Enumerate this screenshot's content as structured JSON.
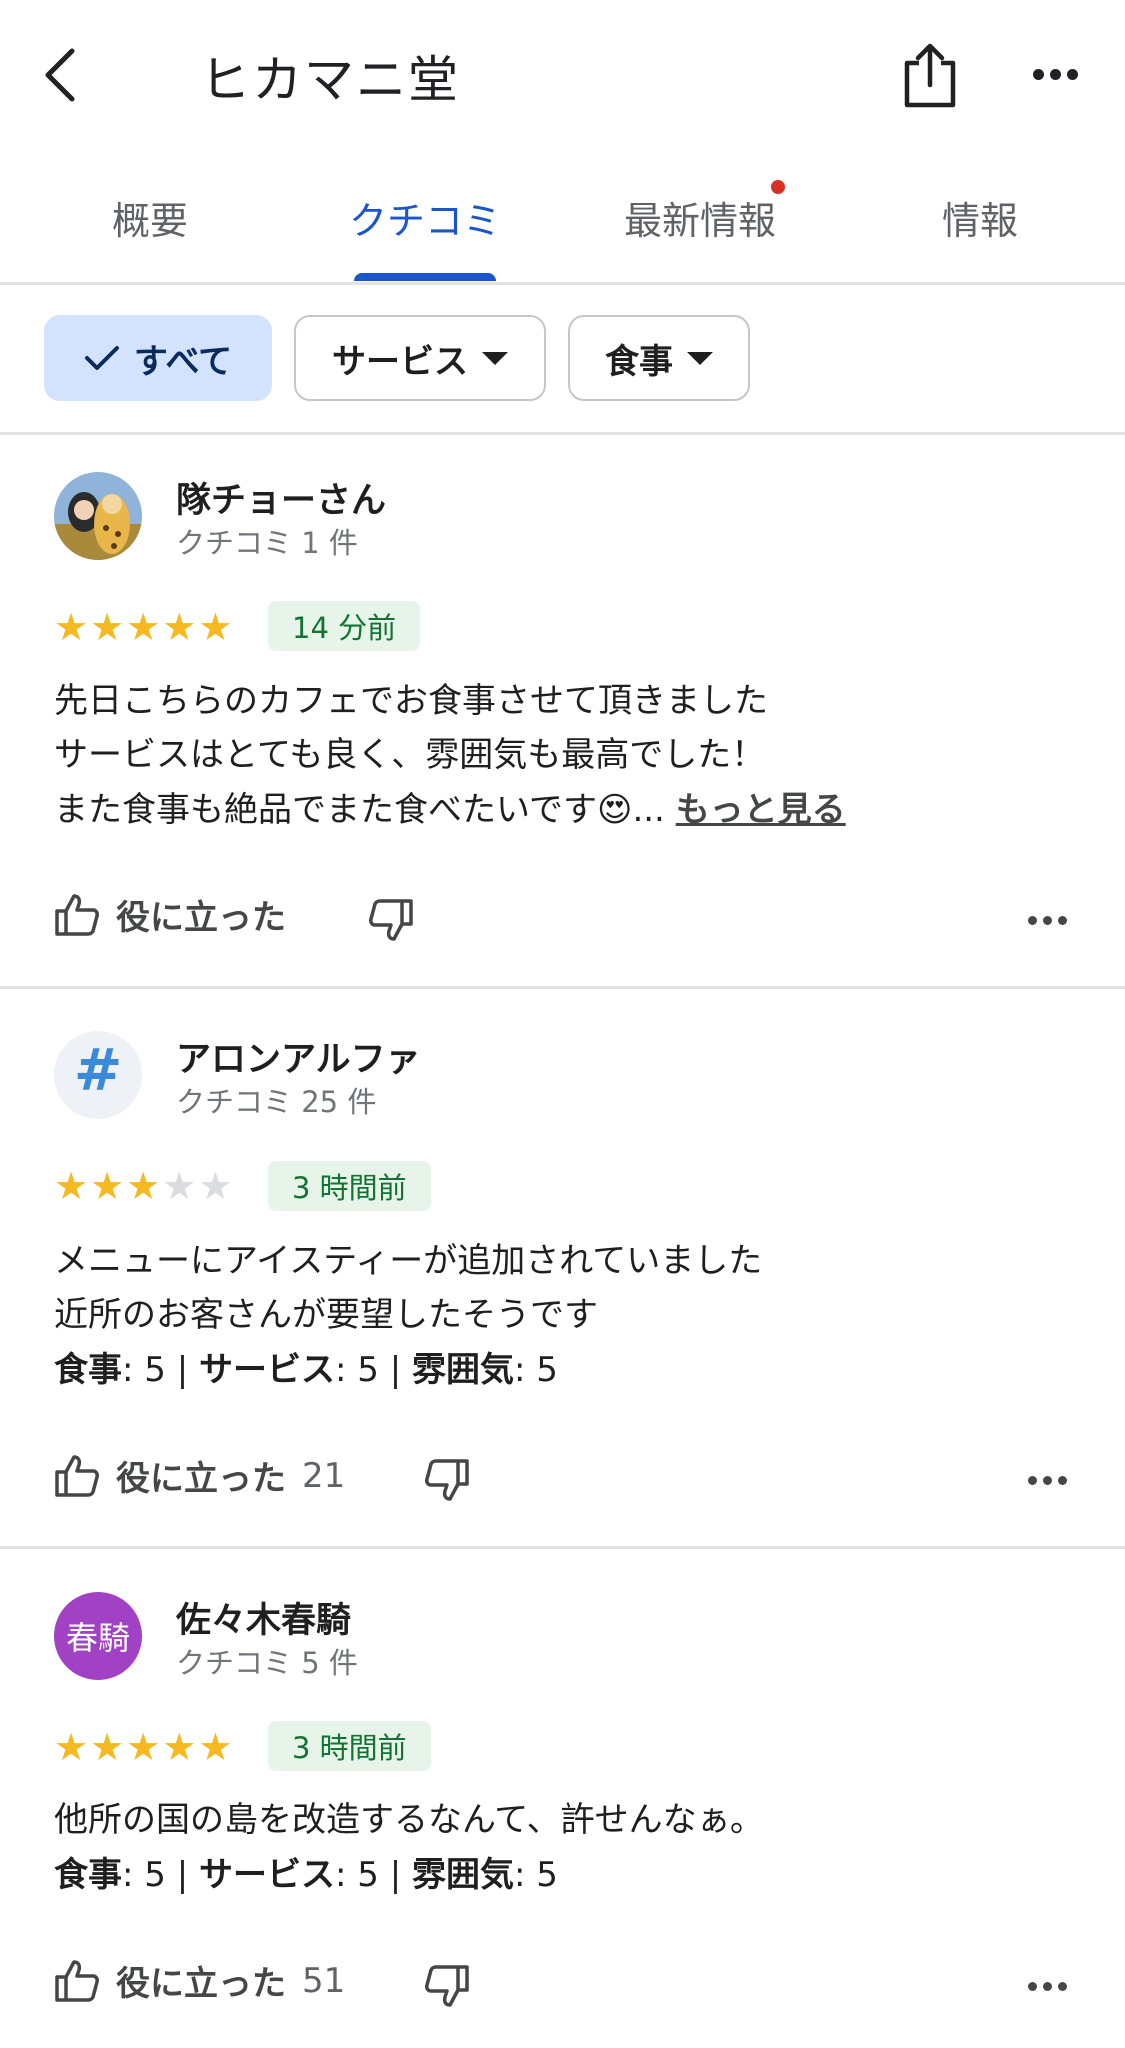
{
  "header": {
    "title": "ヒカマニ堂",
    "back_icon": "chevron-left-icon",
    "share_icon": "share-icon",
    "more_icon": "more-horiz-icon"
  },
  "tabs": [
    {
      "label": "概要"
    },
    {
      "label": "クチコミ",
      "active": true
    },
    {
      "label": "最新情報",
      "has_notification": true
    },
    {
      "label": "情報"
    }
  ],
  "filters": [
    {
      "label": "すべて",
      "selected": true
    },
    {
      "label": "サービス",
      "dropdown": true
    },
    {
      "label": "食事",
      "dropdown": true
    }
  ],
  "reviews": [
    {
      "name": "隊チョーさん",
      "review_count": "クチコミ 1 件",
      "rating": 5,
      "time": "14 分前",
      "lines": [
        "先日こちらのカフェでお食事させて頂きました",
        "サービスはとても良く、雰囲気も最高でした！",
        "また食事も絶品でまた食べたいです"
      ],
      "emoji": "😍",
      "ellipsis": "...",
      "more_label": "もっと見る",
      "helpful_label": "役に立った",
      "helpful_count": ""
    },
    {
      "name": "アロンアルファ",
      "review_count": "クチコミ 25 件",
      "rating": 3,
      "time": "3 時間前",
      "lines": [
        "メニューにアイスティーが追加されていました",
        "近所のお客さんが要望したそうです"
      ],
      "ratings_line": {
        "food_label": "食事",
        "food": "5",
        "service_label": "サービス",
        "service": "5",
        "atmos_label": "雰囲気",
        "atmos": "5"
      },
      "avatar_text": "#",
      "helpful_label": "役に立った",
      "helpful_count": "21"
    },
    {
      "name": "佐々木春騎",
      "review_count": "クチコミ 5 件",
      "rating": 5,
      "time": "3 時間前",
      "lines": [
        "他所の国の島を改造するなんて、許せんなぁ。"
      ],
      "ratings_line": {
        "food_label": "食事",
        "food": "5",
        "service_label": "サービス",
        "service": "5",
        "atmos_label": "雰囲気",
        "atmos": "5"
      },
      "avatar_text": "春騎",
      "avatar_color": "#a142c4",
      "helpful_label": "役に立った",
      "helpful_count": "51"
    }
  ],
  "colors": {
    "accent": "#1a56c9",
    "star": "#f5b921",
    "badge_bg": "#e6f4ea",
    "badge_fg": "#137333"
  }
}
